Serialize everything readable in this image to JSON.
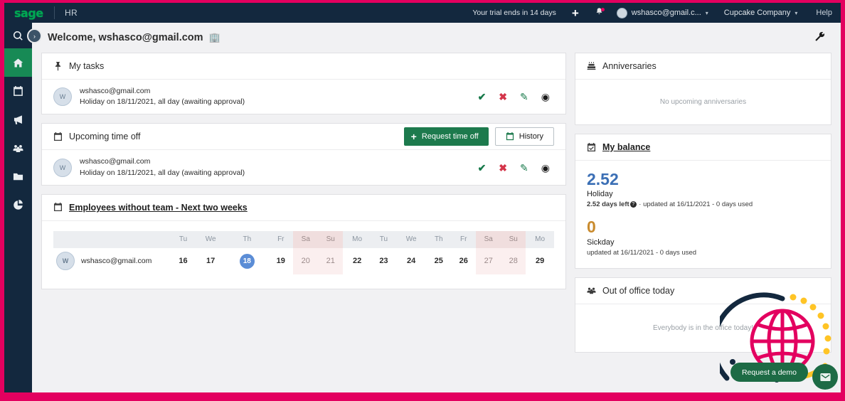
{
  "topbar": {
    "logo": "sage",
    "product": "HR",
    "trial_text": "Your trial ends in 14 days",
    "add_icon": "+",
    "bell_icon": "🔔",
    "user_name": "wshasco@gmail.c...",
    "company_name": "Cupcake Company",
    "help_label": "Help",
    "caret": "▾"
  },
  "sidebar": {
    "items": [
      {
        "name": "search",
        "label": "Search"
      },
      {
        "name": "home",
        "label": "Home"
      },
      {
        "name": "calendar",
        "label": "Calendar"
      },
      {
        "name": "announcements",
        "label": "Announcements"
      },
      {
        "name": "people",
        "label": "People"
      },
      {
        "name": "documents",
        "label": "Documents"
      },
      {
        "name": "reports",
        "label": "Reports"
      }
    ],
    "expand_icon": "›"
  },
  "welcome": {
    "text": "Welcome, wshasco@gmail.com",
    "emoji": "🏢",
    "wrench_icon": "🔧"
  },
  "my_tasks": {
    "title": "My tasks",
    "rows": [
      {
        "avatar_initial": "W",
        "name": "wshasco@gmail.com",
        "detail": "Holiday on 18/11/2021, all day (awaiting approval)",
        "actions": {
          "approve": "✔",
          "reject": "✖",
          "edit": "✎",
          "view": "◉"
        }
      }
    ]
  },
  "upcoming_time_off": {
    "title": "Upcoming time off",
    "request_button": "Request time off",
    "request_plus": "+",
    "history_button": "History",
    "rows": [
      {
        "avatar_initial": "W",
        "name": "wshasco@gmail.com",
        "detail": "Holiday on 18/11/2021, all day (awaiting approval)",
        "actions": {
          "approve": "✔",
          "reject": "✖",
          "edit": "✎",
          "view": "◉"
        }
      }
    ]
  },
  "employees_without_team": {
    "title": "Employees without team - Next two weeks",
    "day_labels": [
      "Tu",
      "We",
      "Th",
      "Fr",
      "Sa",
      "Su",
      "Mo",
      "Tu",
      "We",
      "Th",
      "Fr",
      "Sa",
      "Su",
      "Mo"
    ],
    "weekend_flags": [
      false,
      false,
      false,
      false,
      true,
      true,
      false,
      false,
      false,
      false,
      false,
      true,
      true,
      false
    ],
    "today_index": 2,
    "rows": [
      {
        "avatar_initial": "W",
        "name": "wshasco@gmail.com",
        "days": [
          "16",
          "17",
          "18",
          "19",
          "20",
          "21",
          "22",
          "23",
          "24",
          "25",
          "26",
          "27",
          "28",
          "29"
        ]
      }
    ]
  },
  "anniversaries": {
    "title": "Anniversaries",
    "empty_message": "No upcoming anniversaries"
  },
  "my_balance": {
    "title": "My balance",
    "entries": [
      {
        "value": "2.52",
        "label": "Holiday",
        "sub_prefix": "2.52 days left",
        "sub_suffix": " · updated at 16/11/2021 - 0 days used",
        "has_help": true,
        "color": "#3b6fb5"
      },
      {
        "value": "0",
        "label": "Sickday",
        "sub_prefix": "",
        "sub_suffix": "updated at 16/11/2021 - 0 days used",
        "has_help": false,
        "color": "#c98b2e"
      }
    ]
  },
  "out_of_office": {
    "title": "Out of office today",
    "empty_message": "Everybody is in the office today!"
  },
  "overlay": {
    "demo_button": "Request a demo",
    "chat_icon": "✉"
  },
  "colors": {
    "brand_pink": "#e3005f",
    "navy": "#13283e",
    "green": "#1d7a4d",
    "sage_green": "#00a652",
    "holiday_blue": "#3b6fb5",
    "sick_orange": "#c98b2e",
    "today_blue": "#5b8dd6",
    "weekend_pink": "#fbefef"
  }
}
